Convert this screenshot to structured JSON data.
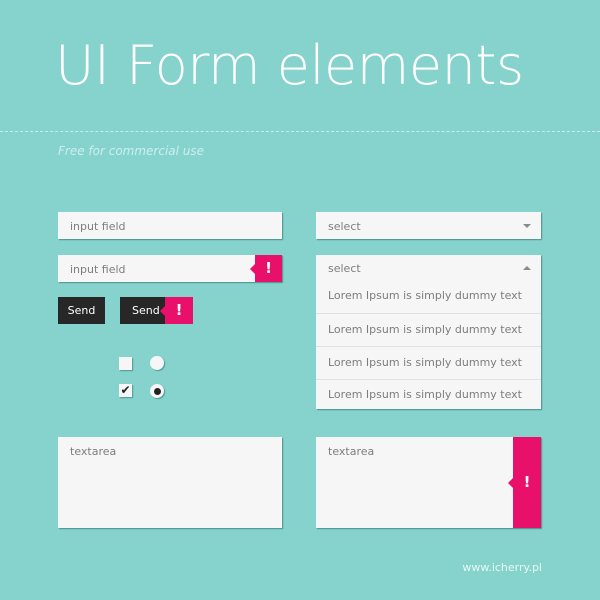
{
  "header": {
    "title": "UI Form elements",
    "subtitle": "Free for commercial use"
  },
  "inputs": [
    {
      "placeholder": "input field",
      "error": false
    },
    {
      "placeholder": "input field",
      "error": true,
      "error_icon": "!"
    }
  ],
  "buttons": [
    {
      "label": "Send",
      "error": false
    },
    {
      "label": "Send",
      "error": true,
      "error_icon": "!"
    }
  ],
  "checkboxes": [
    {
      "checked": false,
      "glyph": ""
    },
    {
      "checked": true,
      "glyph": "✔"
    }
  ],
  "radios": [
    {
      "selected": false
    },
    {
      "selected": true
    }
  ],
  "selects": [
    {
      "value": "select",
      "open": false
    },
    {
      "value": "select",
      "open": true,
      "options": [
        "Lorem Ipsum is simply dummy text",
        "Lorem Ipsum is simply dummy text",
        "Lorem Ipsum is simply dummy text",
        "Lorem Ipsum is simply dummy text"
      ]
    }
  ],
  "textareas": [
    {
      "placeholder": "textarea",
      "error": false
    },
    {
      "placeholder": "textarea",
      "error": true,
      "error_icon": "!"
    }
  ],
  "footer": {
    "text": "www.icherry.pl"
  },
  "colors": {
    "background": "#86d3ce",
    "field": "#f6f6f6",
    "error": "#e8106a",
    "button": "#272727",
    "text_muted": "#7d7d7d"
  }
}
